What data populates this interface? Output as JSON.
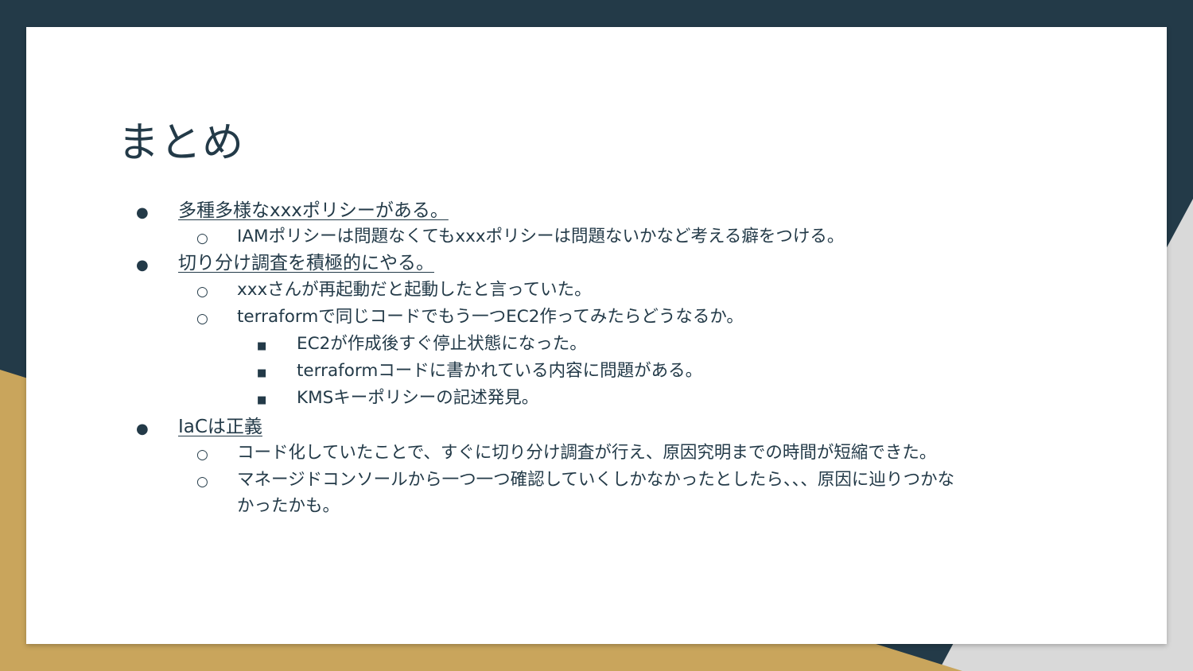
{
  "slide": {
    "title": "まとめ",
    "bullets": [
      {
        "marker": "●",
        "text": "多種多様なxxxポリシーがある。",
        "children": [
          {
            "marker": "○",
            "text": "IAMポリシーは問題なくてもxxxポリシーは問題ないかなど考える癖をつける。"
          }
        ]
      },
      {
        "marker": "●",
        "text": "切り分け調査を積極的にやる。",
        "children": [
          {
            "marker": "○",
            "text": "xxxさんが再起動だと起動したと言っていた。"
          },
          {
            "marker": "○",
            "text": "terraformで同じコードでもう一つEC2作ってみたらどうなるか。",
            "children": [
              {
                "marker": "■",
                "text": "EC2が作成後すぐ停止状態になった。"
              },
              {
                "marker": "■",
                "text": "terraformコードに書かれている内容に問題がある。"
              },
              {
                "marker": "■",
                "text": "KMSキーポリシーの記述発見。"
              }
            ]
          }
        ]
      },
      {
        "marker": "●",
        "text": "IaCは正義",
        "children": [
          {
            "marker": "○",
            "text": "コード化していたことで、すぐに切り分け調査が行え、原因究明までの時間が短縮できた。"
          },
          {
            "marker": "○",
            "text": "マネージドコンソールから一つ一つ確認していくしかなかったとしたら、、、原因に辿りつかな",
            "text_cont": "かったかも。"
          }
        ]
      }
    ]
  },
  "colors": {
    "navy": "#233a48",
    "gold": "#c9a55c",
    "white": "#ffffff",
    "gray": "#d9d9d9"
  }
}
